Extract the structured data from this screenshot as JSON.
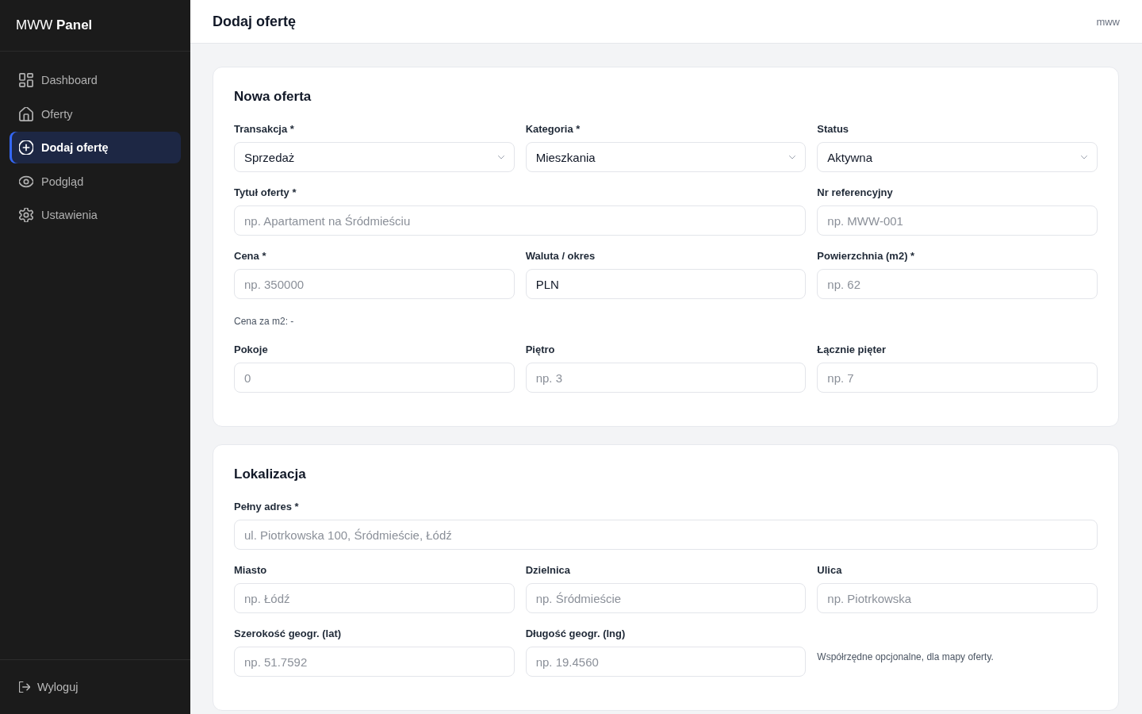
{
  "sidebar": {
    "brand": "MWW **Panel**",
    "items": [
      {
        "label": "Dashboard",
        "selected": false
      },
      {
        "label": "Oferty",
        "selected": false
      },
      {
        "label": "Dodaj ofertę",
        "selected": true
      },
      {
        "label": "Podgląd",
        "selected": false
      },
      {
        "label": "Ustawienia",
        "selected": false
      }
    ],
    "logout": {
      "label": "Wyloguj"
    }
  },
  "header": {
    "title": "Dodaj ofertę",
    "user": "mww"
  },
  "sections": [
    {
      "title": "Nowa oferta",
      "rows": [
        {
          "items": [
            {
              "kind": "select",
              "label": "Transakcja *",
              "value": "Sprzedaż"
            },
            {
              "kind": "select",
              "label": "Kategoria *",
              "value": "Mieszkania"
            },
            {
              "kind": "select",
              "label": "Status",
              "value": "Aktywna"
            }
          ]
        },
        {
          "items": [
            {
              "kind": "input",
              "label": "Tytuł oferty *",
              "placeholder": "np. Apartament na Śródmieściu"
            },
            {
              "kind": "input",
              "label": "Nr referencyjny",
              "placeholder": "np. MWW-001"
            }
          ]
        },
        {
          "items": [
            {
              "kind": "input",
              "label": "Cena *",
              "placeholder": "np. 350000"
            },
            {
              "kind": "input",
              "label": "Waluta / okres",
              "value": "PLN"
            },
            {
              "kind": "input",
              "label": "Powierzchnia (m2) *",
              "placeholder": "np. 62"
            }
          ]
        },
        {
          "items": [
            {
              "kind": "note",
              "text": "Cena za m2: -"
            }
          ]
        },
        {
          "items": [
            {
              "kind": "input",
              "label": "Pokoje",
              "placeholder": "0"
            },
            {
              "kind": "input",
              "label": "Piętro",
              "placeholder": "np. 3"
            },
            {
              "kind": "input",
              "label": "Łącznie pięter",
              "placeholder": "np. 7"
            }
          ]
        }
      ]
    },
    {
      "title": "Lokalizacja",
      "rows": [
        {
          "items": [
            {
              "kind": "input",
              "label": "Pełny adres *",
              "placeholder": "ul. Piotrkowska 100, Śródmieście, Łódź"
            }
          ]
        },
        {
          "items": [
            {
              "kind": "input",
              "label": "Miasto",
              "placeholder": "np. Łódź"
            },
            {
              "kind": "input",
              "label": "Dzielnica",
              "placeholder": "np. Śródmieście"
            },
            {
              "kind": "input",
              "label": "Ulica",
              "placeholder": "np. Piotrkowska"
            }
          ]
        },
        {
          "items": [
            {
              "kind": "input",
              "label": "Szerokość geogr. (lat)",
              "placeholder": "np. 51.7592"
            },
            {
              "kind": "input",
              "label": "Długość geogr. (lng)",
              "placeholder": "np. 19.4560"
            },
            {
              "kind": "hint",
              "text": "Współrzędne opcjonalne, dla mapy oferty."
            }
          ]
        }
      ]
    }
  ]
}
